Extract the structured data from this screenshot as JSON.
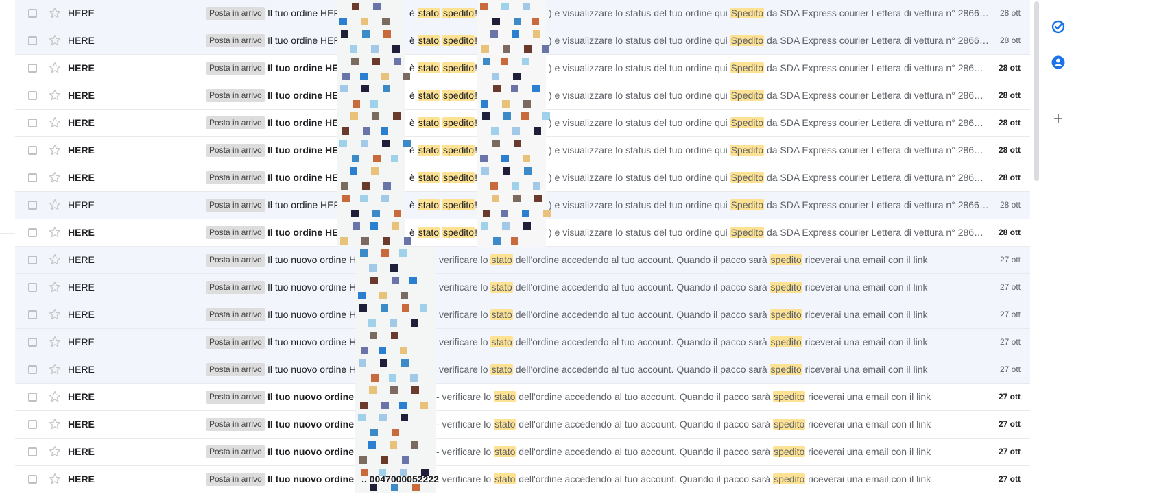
{
  "inbox_label": "Posta in arrivo",
  "threads": [
    {
      "sender": "HERE",
      "unread": false,
      "variant": "A",
      "subject": "Il tuo ordine HERE n°",
      "mid_pre": "è ",
      "mid_h1": "stato",
      "mid_sp": " ",
      "mid_h2": "spedito",
      "mid_post": "! - ",
      "snippet_pre": ") e visualizzare lo status del tuo ordine qui ",
      "snippet_hl": "Spedito",
      "snippet_post": " da SDA Express courier Lettera di vettura n° 2866…",
      "date": "28 ott"
    },
    {
      "sender": "HERE",
      "unread": false,
      "variant": "A",
      "subject": "Il tuo ordine HERE n°",
      "mid_pre": "è ",
      "mid_h1": "stato",
      "mid_sp": " ",
      "mid_h2": "spedito",
      "mid_post": "! - ",
      "snippet_pre": ") e visualizzare lo status del tuo ordine qui ",
      "snippet_hl": "Spedito",
      "snippet_post": " da SDA Express courier Lettera di vettura n° 2866…",
      "date": "28 ott"
    },
    {
      "sender": "HERE",
      "unread": true,
      "variant": "A",
      "subject": "Il tuo ordine HERE n°",
      "mid_pre": "è ",
      "mid_h1": "stato",
      "mid_sp": " ",
      "mid_h2": "spedito",
      "mid_post": "! - ",
      "snippet_pre": ") e visualizzare lo status del tuo ordine qui ",
      "snippet_hl": "Spedito",
      "snippet_post": " da SDA Express courier Lettera di vettura n° 286…",
      "date": "28 ott"
    },
    {
      "sender": "HERE",
      "unread": true,
      "variant": "A",
      "subject": "Il tuo ordine HERE n°",
      "mid_pre": "è ",
      "mid_h1": "stato",
      "mid_sp": " ",
      "mid_h2": "spedito",
      "mid_post": "! - ",
      "snippet_pre": ") e visualizzare lo status del tuo ordine qui ",
      "snippet_hl": "Spedito",
      "snippet_post": " da SDA Express courier Lettera di vettura n° 286…",
      "date": "28 ott"
    },
    {
      "sender": "HERE",
      "unread": true,
      "variant": "A",
      "subject": "Il tuo ordine HERE n°",
      "mid_pre": "è ",
      "mid_h1": "stato",
      "mid_sp": " ",
      "mid_h2": "spedito",
      "mid_post": "! - ",
      "snippet_pre": ") e visualizzare lo status del tuo ordine qui ",
      "snippet_hl": "Spedito",
      "snippet_post": " da SDA Express courier Lettera di vettura n° 286…",
      "date": "28 ott"
    },
    {
      "sender": "HERE",
      "unread": true,
      "variant": "A",
      "subject": "Il tuo ordine HERE n°",
      "mid_pre": "è ",
      "mid_h1": "stato",
      "mid_sp": " ",
      "mid_h2": "spedito",
      "mid_post": "! - ",
      "snippet_pre": ") e visualizzare lo status del tuo ordine qui ",
      "snippet_hl": "Spedito",
      "snippet_post": " da SDA Express courier Lettera di vettura n° 286…",
      "date": "28 ott"
    },
    {
      "sender": "HERE",
      "unread": true,
      "variant": "A",
      "subject": "Il tuo ordine HERE n°",
      "mid_pre": "è ",
      "mid_h1": "stato",
      "mid_sp": " ",
      "mid_h2": "spedito",
      "mid_post": "! - ",
      "snippet_pre": ") e visualizzare lo status del tuo ordine qui ",
      "snippet_hl": "Spedito",
      "snippet_post": " da SDA Express courier Lettera di vettura n° 286…",
      "date": "28 ott"
    },
    {
      "sender": "HERE",
      "unread": false,
      "variant": "A",
      "subject": "Il tuo ordine HERE n°",
      "mid_pre": "è ",
      "mid_h1": "stato",
      "mid_sp": " ",
      "mid_h2": "spedito",
      "mid_post": "! - ",
      "snippet_pre": ") e visualizzare lo status del tuo ordine qui ",
      "snippet_hl": "Spedito",
      "snippet_post": " da SDA Express courier Lettera di vettura n° 2866…",
      "date": "28 ott"
    },
    {
      "sender": "HERE",
      "unread": true,
      "variant": "A",
      "subject": "Il tuo ordine HERE n°",
      "mid_pre": "è ",
      "mid_h1": "stato",
      "mid_sp": " ",
      "mid_h2": "spedito",
      "mid_post": "! - ",
      "snippet_pre": ") e visualizzare lo status del tuo ordine qui ",
      "snippet_hl": "Spedito",
      "snippet_post": " da SDA Express courier Lettera di vettura n° 286…",
      "date": "28 ott"
    },
    {
      "sender": "HERE",
      "unread": false,
      "variant": "B",
      "subject": "Il tuo nuovo ordine HERE",
      "snippet_pre": "verificare lo ",
      "snippet_h1": "stato",
      "snippet_mid": " dell'ordine accedendo al tuo account. Quando il pacco sarà ",
      "snippet_h2": "spedito",
      "snippet_post": " riceverai una email con il link",
      "date": "27 ott"
    },
    {
      "sender": "HERE",
      "unread": false,
      "variant": "B",
      "subject": "Il tuo nuovo ordine HERE",
      "snippet_pre": "verificare lo ",
      "snippet_h1": "stato",
      "snippet_mid": " dell'ordine accedendo al tuo account. Quando il pacco sarà ",
      "snippet_h2": "spedito",
      "snippet_post": " riceverai una email con il link",
      "date": "27 ott"
    },
    {
      "sender": "HERE",
      "unread": false,
      "variant": "B",
      "subject": "Il tuo nuovo ordine HERE",
      "snippet_pre": "verificare lo ",
      "snippet_h1": "stato",
      "snippet_mid": " dell'ordine accedendo al tuo account. Quando il pacco sarà ",
      "snippet_h2": "spedito",
      "snippet_post": " riceverai una email con il link",
      "date": "27 ott"
    },
    {
      "sender": "HERE",
      "unread": false,
      "variant": "B",
      "subject": "Il tuo nuovo ordine HERE",
      "snippet_pre": "verificare lo ",
      "snippet_h1": "stato",
      "snippet_mid": " dell'ordine accedendo al tuo account. Quando il pacco sarà ",
      "snippet_h2": "spedito",
      "snippet_post": " riceverai una email con il link",
      "date": "27 ott"
    },
    {
      "sender": "HERE",
      "unread": false,
      "variant": "B",
      "subject": "Il tuo nuovo ordine HERE",
      "snippet_pre": "verificare lo ",
      "snippet_h1": "stato",
      "snippet_mid": " dell'ordine accedendo al tuo account. Quando il pacco sarà ",
      "snippet_h2": "spedito",
      "snippet_post": " riceverai una email con il link",
      "date": "27 ott"
    },
    {
      "sender": "HERE",
      "unread": true,
      "variant": "B",
      "subject": "Il tuo nuovo ordine HERE",
      "snippet_pre": "- verificare lo ",
      "snippet_h1": "stato",
      "snippet_mid": " dell'ordine accedendo al tuo account. Quando il pacco sarà ",
      "snippet_h2": "spedito",
      "snippet_post": " riceverai una email con il link",
      "date": "27 ott"
    },
    {
      "sender": "HERE",
      "unread": true,
      "variant": "B",
      "subject": "Il tuo nuovo ordine HERE",
      "snippet_pre": "- verificare lo ",
      "snippet_h1": "stato",
      "snippet_mid": " dell'ordine accedendo al tuo account. Quando il pacco sarà ",
      "snippet_h2": "spedito",
      "snippet_post": " riceverai una email con il link",
      "date": "27 ott"
    },
    {
      "sender": "HERE",
      "unread": true,
      "variant": "B",
      "subject": "Il tuo nuovo ordine HERE",
      "snippet_pre": "- verificare lo ",
      "snippet_h1": "stato",
      "snippet_mid": " dell'ordine accedendo al tuo account. Quando il pacco sarà ",
      "snippet_h2": "spedito",
      "snippet_post": " riceverai una email con il link",
      "date": "27 ott"
    },
    {
      "sender": "HERE",
      "unread": true,
      "variant": "B",
      "subject": "Il tuo nuovo ordine HERE",
      "subject_tail": ".. 0047000052222",
      "snippet_pre": "- verificare lo ",
      "snippet_h1": "stato",
      "snippet_mid": " dell'ordine accedendo al tuo account. Quando il pacco sarà ",
      "snippet_h2": "spedito",
      "snippet_post": " riceverai una email con il link",
      "date": "27 ott"
    }
  ],
  "colors": {
    "highlight": "#fde293",
    "read_row_bg": "#f2f6fc",
    "label_bg": "#dddddd",
    "side_icon_blue": "#1a73e8"
  },
  "side_panel": {
    "icons": [
      "tasks-icon",
      "contacts-icon",
      "add-icon"
    ]
  }
}
